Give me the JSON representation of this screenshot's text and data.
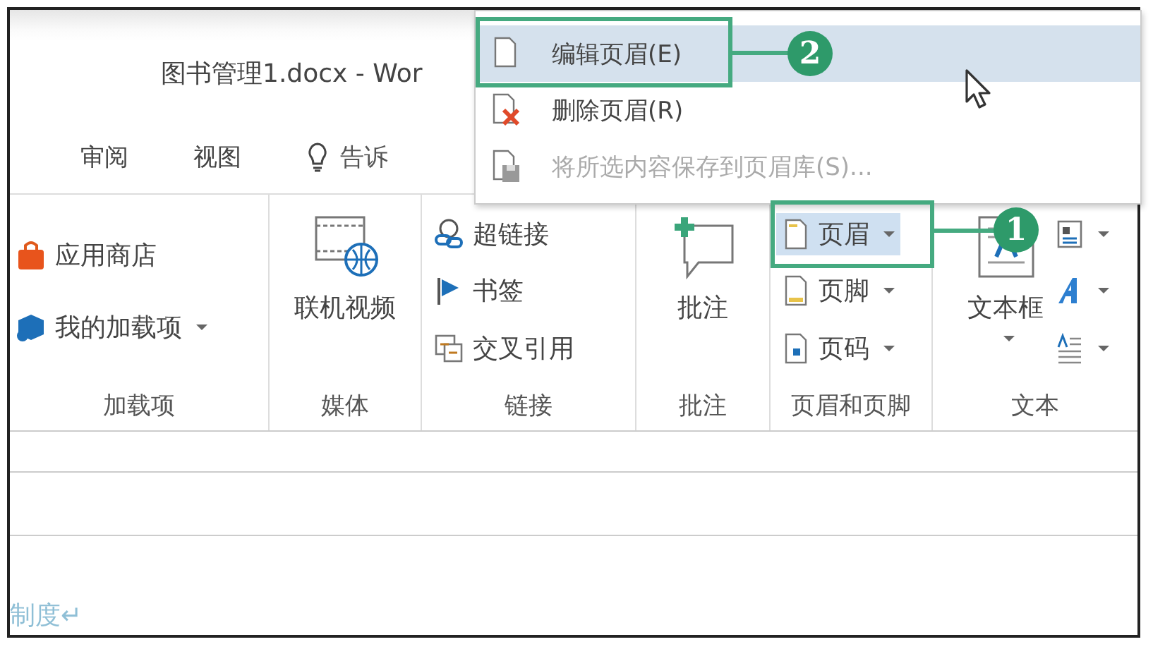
{
  "window": {
    "title": "图书管理1.docx - Wor"
  },
  "tabs": [
    {
      "label": "审阅",
      "selected": false
    },
    {
      "label": "视图",
      "selected": false
    }
  ],
  "tell_me": {
    "label": "告诉"
  },
  "ribbon_groups": [
    {
      "label": "加载项",
      "items": [
        {
          "kind": "small",
          "label": "应用商店",
          "dropdown": false,
          "highlighted": false
        },
        {
          "kind": "small",
          "label": "我的加载项",
          "dropdown": true,
          "highlighted": false
        }
      ]
    },
    {
      "label": "媒体",
      "items": [
        {
          "kind": "large",
          "label": "联机视频",
          "dropdown": false,
          "highlighted": false
        }
      ]
    },
    {
      "label": "链接",
      "items": [
        {
          "kind": "small",
          "label": "超链接",
          "dropdown": false,
          "highlighted": false
        },
        {
          "kind": "small",
          "label": "书签",
          "dropdown": false,
          "highlighted": false
        },
        {
          "kind": "small",
          "label": "交叉引用",
          "dropdown": false,
          "highlighted": false
        }
      ]
    },
    {
      "label": "批注",
      "items": [
        {
          "kind": "large",
          "label": "批注",
          "dropdown": false,
          "highlighted": false
        }
      ]
    },
    {
      "label": "页眉和页脚",
      "items": [
        {
          "kind": "small",
          "label": "页眉",
          "dropdown": true,
          "highlighted": true
        },
        {
          "kind": "small",
          "label": "页脚",
          "dropdown": true,
          "highlighted": false
        },
        {
          "kind": "small",
          "label": "页码",
          "dropdown": true,
          "highlighted": false
        }
      ]
    },
    {
      "label": "文本",
      "items": [
        {
          "kind": "large",
          "label": "文本框",
          "dropdown": true,
          "highlighted": false
        },
        {
          "kind": "icon",
          "dropdown": true,
          "highlighted": false
        },
        {
          "kind": "icon",
          "dropdown": true,
          "highlighted": false
        },
        {
          "kind": "icon",
          "dropdown": true,
          "highlighted": false
        }
      ]
    }
  ],
  "menu": {
    "items": [
      {
        "label": "编辑页眉(E)",
        "highlighted": true,
        "disabled": false
      },
      {
        "label": "删除页眉(R)",
        "highlighted": false,
        "disabled": false
      },
      {
        "label": "将所选内容保存到页眉库(S)...",
        "highlighted": false,
        "disabled": true
      }
    ]
  },
  "callouts": [
    {
      "number": "1"
    },
    {
      "number": "2"
    }
  ],
  "document": {
    "text": "制度↵"
  }
}
